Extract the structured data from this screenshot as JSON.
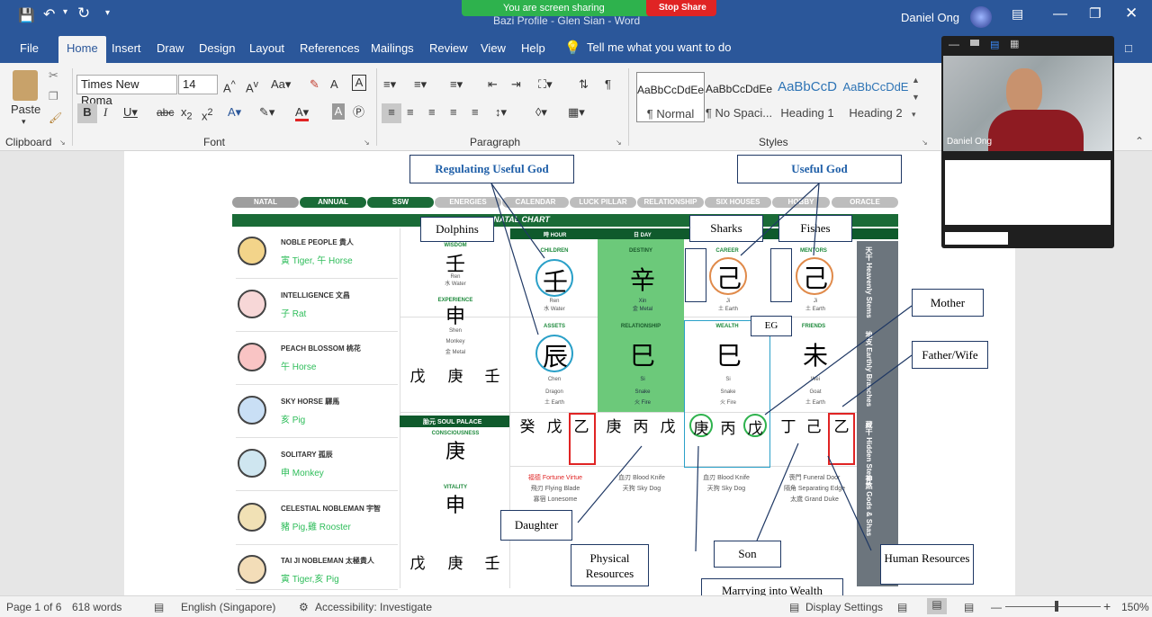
{
  "titlebar": {
    "doc_title": "Bazi Profile - Glen Sian - Word",
    "user": "Daniel Ong",
    "sharing_text": "You are screen sharing",
    "stop_share": "Stop Share"
  },
  "tabs": [
    "File",
    "Home",
    "Insert",
    "Draw",
    "Design",
    "Layout",
    "References",
    "Mailings",
    "Review",
    "View",
    "Help"
  ],
  "tell_me": "Tell me what you want to do",
  "ribbon": {
    "paste": "Paste",
    "clipboard": "Clipboard",
    "font": "Font",
    "paragraph": "Paragraph",
    "styles": "Styles",
    "font_name": "Times New Roma",
    "font_size": "14",
    "style_items": [
      {
        "preview": "AaBbCcDdEe",
        "name": "¶ Normal"
      },
      {
        "preview": "AaBbCcDdEe",
        "name": "¶ No Spaci..."
      },
      {
        "preview": "AaBbCcD",
        "name": "Heading 1"
      },
      {
        "preview": "AaBbCcDdE",
        "name": "Heading 2"
      }
    ]
  },
  "zoom": {
    "participant": "Daniel Ong"
  },
  "callouts": {
    "regulating": "Regulating Useful God",
    "useful": "Useful God",
    "dolphins": "Dolphins",
    "sharks": "Sharks",
    "fishes": "Fishes",
    "mother": "Mother",
    "father_wife": "Father/Wife",
    "eg": "EG",
    "daughter": "Daughter",
    "physical": "Physical Resources",
    "son": "Son",
    "human": "Human Resources",
    "marrying": "Marrying into Wealth"
  },
  "nav": [
    "NATAL",
    "ANNUAL",
    "SSW",
    "ENERGIES",
    "CALENDAR",
    "LUCK PILLAR",
    "RELATIONSHIP",
    "SIX HOUSES",
    "HOBBY",
    "ORACLE"
  ],
  "chart_title": "NATAL CHART",
  "columns": [
    "時 HOUR",
    "日 DAY"
  ],
  "left_items": [
    {
      "title": "NOBLE PEOPLE 貴人",
      "value": "寅 Tiger, 午 Horse"
    },
    {
      "title": "INTELLIGENCE 文昌",
      "value": "子 Rat"
    },
    {
      "title": "PEACH BLOSSOM 桃花",
      "value": "午 Horse"
    },
    {
      "title": "SKY HORSE 驛馬",
      "value": "亥 Pig"
    },
    {
      "title": "SOLITARY 孤辰",
      "value": "申 Monkey"
    },
    {
      "title": "CELESTIAL NOBLEMAN 宇智",
      "value": "豬 Pig,雞 Rooster"
    },
    {
      "title": "TAI JI NOBLEMAN 太極貴人",
      "value": "寅 Tiger,亥 Pig"
    }
  ],
  "cells": {
    "wisdom": "WISDOM",
    "children": "CHILDREN",
    "destiny": "DESTINY",
    "career": "CAREER",
    "mentors": "MENTORS",
    "experience": "EXPERIENCE",
    "assets": "ASSETS",
    "relationship": "RELATIONSHIP",
    "wealth": "WEALTH",
    "friends": "FRIENDS",
    "soul": "胎元 SOUL PALACE",
    "consciousness": "CONSCIOUSNESS",
    "vitality": "VITALITY"
  },
  "chars": {
    "ren": "壬",
    "xin": "辛",
    "ji": "己",
    "shen": "申",
    "chen": "辰",
    "si": "巳",
    "wei": "未",
    "geng": "庚",
    "wu": "戊",
    "bing": "丙",
    "gui": "癸",
    "yi": "乙",
    "ding": "丁"
  },
  "subs": {
    "ren": "Ren",
    "water": "水 Water",
    "xin": "Xin",
    "metal": "金 Metal",
    "ji": "Ji",
    "earth": "土 Earth",
    "shen": "Shen",
    "monkey": "Monkey",
    "chen": "Chen",
    "dragon": "Dragon",
    "si": "Si",
    "snake": "Snake",
    "fire": "火 Fire",
    "wei": "Wei",
    "goat": "Goat"
  },
  "stars_row": [
    {
      "a": "福德 Fortune Virtue",
      "b": "飛刃 Flying Blade",
      "c": "寡宿 Lonesome"
    },
    {
      "a": "血刃 Blood Knife",
      "b": "天狗 Sky Dog"
    },
    {
      "a": "血刃 Blood Knife",
      "b": "天狗 Sky Dog"
    },
    {
      "a": "喪門 Funeral Door",
      "b": "隔角 Separating Edge",
      "c": "太歲 Grand Duke"
    }
  ],
  "side_labels": [
    "天干 Heavenly Stems",
    "地支 Earthly Branches",
    "藏干 Hidden Stems",
    "神煞 Gods & Shas"
  ],
  "status": {
    "page": "Page 1 of 6",
    "words": "618 words",
    "lang": "English (Singapore)",
    "access": "Accessibility: Investigate",
    "display": "Display Settings",
    "zoom": "150%"
  }
}
